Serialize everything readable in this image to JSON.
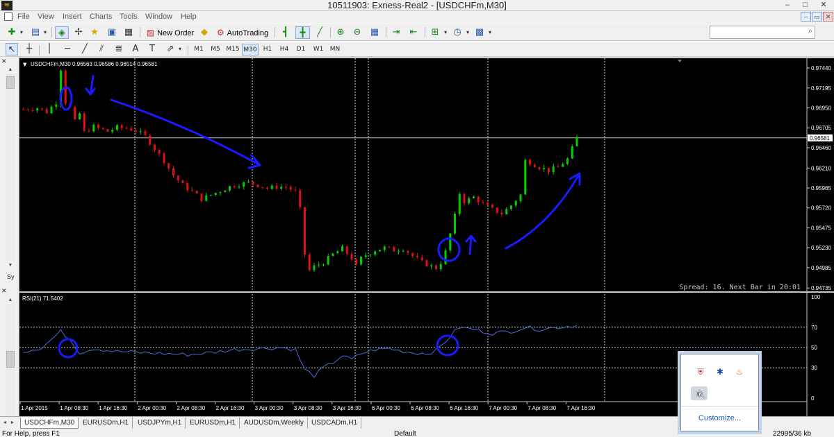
{
  "window": {
    "title": "10511903: Exness-Real2 - [USDCHFm,M30]",
    "minimize": "–",
    "maximize": "□",
    "close": "✕"
  },
  "menu": {
    "items": [
      "File",
      "View",
      "Insert",
      "Charts",
      "Tools",
      "Window",
      "Help"
    ],
    "mdi_minimize": "–",
    "mdi_restore": "▭",
    "mdi_close": "✕"
  },
  "toolbar": {
    "new_order": "New Order",
    "autotrading": "AutoTrading",
    "timeframes": [
      "M1",
      "M5",
      "M15",
      "M30",
      "H1",
      "H4",
      "D1",
      "W1",
      "MN"
    ],
    "active_timeframe": "M30",
    "search_placeholder": ""
  },
  "icons": {
    "new_chart": "✚",
    "profiles": "▤",
    "market_watch": "◈",
    "navigator": "✢",
    "data_window": "★",
    "terminal": "▣",
    "tester": "▦",
    "new_order": "▨",
    "metaeditor": "◆",
    "autotrading": "⚙",
    "bar_chart": "┫",
    "candles": "╋",
    "line_chart": "╱",
    "zoom_in": "⊕",
    "zoom_out": "⊖",
    "tile": "▦",
    "autoscroll": "⇥",
    "chart_shift": "⇤",
    "indicators": "⊞",
    "periods": "◷",
    "templates": "▩",
    "cursor": "↖",
    "crosshair": "┼",
    "vline": "│",
    "hline": "─",
    "trendline": "╱",
    "channel": "⫽",
    "fibo": "≣",
    "text": "A",
    "label": "T",
    "arrows": "⇗",
    "search": "⌕",
    "antivirus": "⛨",
    "bluetooth": "✱",
    "flame": "♨",
    "usb": "◉",
    "mouse_cursor": "↖"
  },
  "left_panel": {
    "close_label": "✕",
    "symbols_tab": "Sy",
    "indicator_close": "✕"
  },
  "chart": {
    "header": "USDCHFm,M30  0.96563 0.96586 0.96514 0.96581",
    "symbol": "USDCHFm",
    "timeframe": "M30",
    "ohlc": {
      "open": 0.96563,
      "high": 0.96586,
      "low": 0.96514,
      "close": 0.96581
    },
    "spread_label": "Spread: 16. Next Bar in 20:01",
    "current_price_label": "0.96581",
    "colors": {
      "bull": "#00d000",
      "bear": "#e01010",
      "background": "#000000",
      "annotation": "#1a1aff",
      "rsi_line": "#4d6bd6"
    }
  },
  "chart_data": {
    "type": "candlestick",
    "series": [
      {
        "name": "USDCHFm,M30",
        "kind": "price"
      },
      {
        "name": "RSI(21)",
        "kind": "oscillator"
      }
    ],
    "price_axis": [
      "0.97440",
      "0.97195",
      "0.96950",
      "0.96705",
      "0.96460",
      "0.96210",
      "0.95965",
      "0.95720",
      "0.95475",
      "0.95230",
      "0.94985",
      "0.94735"
    ],
    "price_range": [
      0.9472,
      0.975
    ],
    "time_axis": [
      "1 Apr 2015",
      "1 Apr 08:30",
      "1 Apr 16:30",
      "2 Apr 00:30",
      "2 Apr 08:30",
      "2 Apr 16:30",
      "3 Apr 00:30",
      "3 Apr 08:30",
      "3 Apr 16:30",
      "6 Apr 00:30",
      "6 Apr 08:30",
      "6 Apr 16:30",
      "7 Apr 00:30",
      "7 Apr 08:30",
      "7 Apr 16:30"
    ],
    "price_path": [
      [
        0,
        0.9693
      ],
      [
        3,
        0.9695
      ],
      [
        5,
        0.969
      ],
      [
        7,
        0.9702
      ],
      [
        8,
        0.9743
      ],
      [
        9,
        0.9702
      ],
      [
        10,
        0.9695
      ],
      [
        11,
        0.9678
      ],
      [
        12,
        0.9688
      ],
      [
        13,
        0.9665
      ],
      [
        15,
        0.9672
      ],
      [
        18,
        0.9666
      ],
      [
        20,
        0.9671
      ],
      [
        22,
        0.967
      ],
      [
        24,
        0.9667
      ],
      [
        26,
        0.966
      ],
      [
        28,
        0.9645
      ],
      [
        30,
        0.963
      ],
      [
        32,
        0.9612
      ],
      [
        34,
        0.96
      ],
      [
        36,
        0.9592
      ],
      [
        38,
        0.9583
      ],
      [
        40,
        0.9588
      ],
      [
        42,
        0.9593
      ],
      [
        44,
        0.9598
      ],
      [
        46,
        0.9601
      ],
      [
        48,
        0.9603
      ],
      [
        50,
        0.96
      ],
      [
        52,
        0.9596
      ],
      [
        54,
        0.9598
      ],
      [
        56,
        0.9598
      ],
      [
        58,
        0.9592
      ],
      [
        59,
        0.957
      ],
      [
        60,
        0.9515
      ],
      [
        61,
        0.9495
      ],
      [
        62,
        0.95
      ],
      [
        64,
        0.9505
      ],
      [
        66,
        0.9515
      ],
      [
        68,
        0.9522
      ],
      [
        70,
        0.951
      ],
      [
        71,
        0.95
      ],
      [
        72,
        0.951
      ],
      [
        73,
        0.9514
      ],
      [
        75,
        0.952
      ],
      [
        77,
        0.9523
      ],
      [
        79,
        0.952
      ],
      [
        81,
        0.9522
      ],
      [
        83,
        0.9513
      ],
      [
        85,
        0.9505
      ],
      [
        87,
        0.95
      ],
      [
        88,
        0.9498
      ],
      [
        89,
        0.9505
      ],
      [
        90,
        0.9518
      ],
      [
        91,
        0.954
      ],
      [
        92,
        0.9562
      ],
      [
        93,
        0.959
      ],
      [
        94,
        0.958
      ],
      [
        96,
        0.9585
      ],
      [
        98,
        0.9577
      ],
      [
        100,
        0.957
      ],
      [
        102,
        0.9565
      ],
      [
        104,
        0.9575
      ],
      [
        106,
        0.9588
      ],
      [
        107,
        0.963
      ],
      [
        108,
        0.9628
      ],
      [
        110,
        0.9622
      ],
      [
        112,
        0.9618
      ],
      [
        114,
        0.9622
      ],
      [
        116,
        0.9632
      ],
      [
        117,
        0.9645
      ],
      [
        118,
        0.9658
      ]
    ],
    "rsi": {
      "label": "RSI(21) 71.5402",
      "period": 21,
      "last": 71.5402,
      "levels": [
        30,
        50,
        70
      ],
      "axis": [
        "100",
        "70",
        "50",
        "30",
        "0"
      ],
      "path": [
        [
          0,
          46
        ],
        [
          4,
          50
        ],
        [
          7,
          62
        ],
        [
          8,
          66
        ],
        [
          10,
          58
        ],
        [
          12,
          45
        ],
        [
          15,
          49
        ],
        [
          20,
          46
        ],
        [
          25,
          45
        ],
        [
          30,
          44
        ],
        [
          35,
          43
        ],
        [
          40,
          45
        ],
        [
          45,
          48
        ],
        [
          50,
          49
        ],
        [
          55,
          50
        ],
        [
          58,
          48
        ],
        [
          60,
          28
        ],
        [
          62,
          22
        ],
        [
          64,
          30
        ],
        [
          66,
          35
        ],
        [
          68,
          42
        ],
        [
          70,
          38
        ],
        [
          72,
          44
        ],
        [
          75,
          48
        ],
        [
          78,
          49
        ],
        [
          80,
          47
        ],
        [
          83,
          45
        ],
        [
          86,
          44
        ],
        [
          88,
          47
        ],
        [
          90,
          56
        ],
        [
          92,
          66
        ],
        [
          93,
          70
        ],
        [
          96,
          68
        ],
        [
          100,
          64
        ],
        [
          104,
          66
        ],
        [
          107,
          70
        ],
        [
          110,
          68
        ],
        [
          114,
          70
        ],
        [
          118,
          72
        ]
      ]
    }
  },
  "tabs": [
    "USDCHFm,M30",
    "EURUSDm,H1",
    "USDJPYm,H1",
    "EURUSDm,H1",
    "AUDUSDm,Weekly",
    "USDCADm,H1"
  ],
  "active_tab": "USDCHFm,M30",
  "tab_scroll_left": "◄",
  "tab_scroll_right": "►",
  "status": {
    "help": "For Help, press F1",
    "profile": "Default",
    "traffic": "22995/36 kb"
  },
  "tray": {
    "customize": "Customize..."
  }
}
